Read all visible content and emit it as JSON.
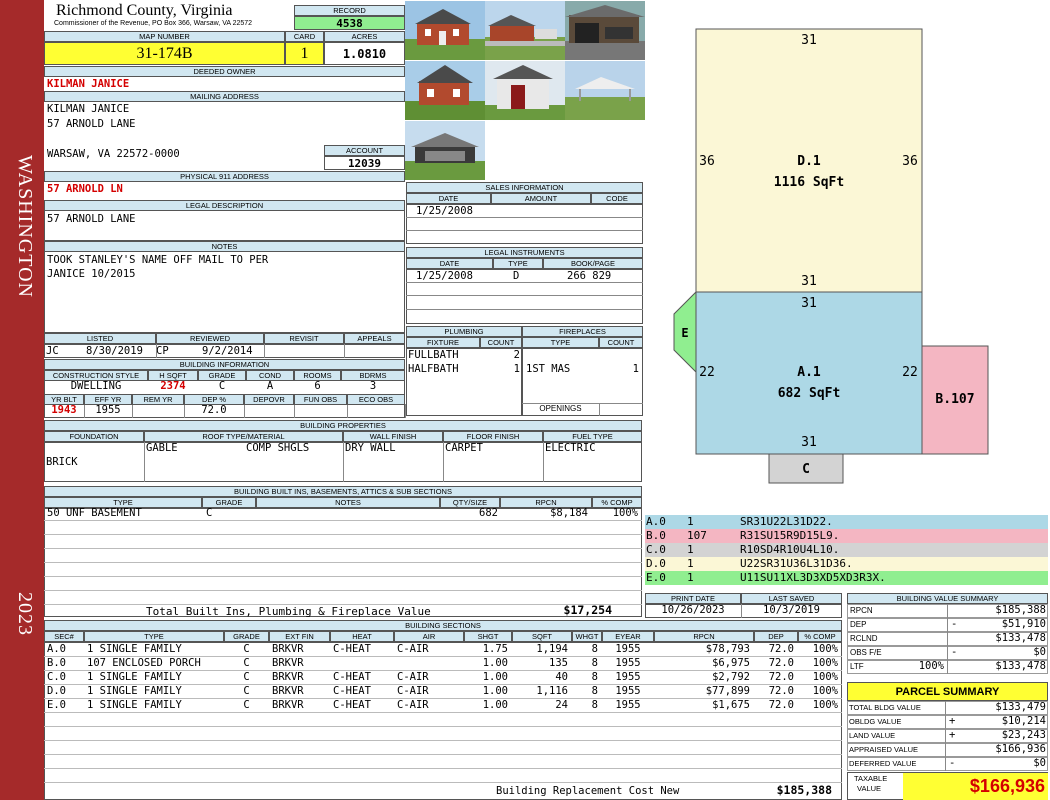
{
  "county": {
    "name": "Richmond County, Virginia",
    "office": "Commissioner of the Revenue, PO Box 366, Warsaw, VA 22572"
  },
  "side": {
    "district": "WASHINGTON",
    "year": "2023"
  },
  "record": {
    "label": "RECORD",
    "value": "4538"
  },
  "map": {
    "label": "MAP NUMBER",
    "value": "31-174B",
    "card_label": "CARD",
    "card": "1",
    "acres_label": "ACRES",
    "acres": "1.0810"
  },
  "deeded": {
    "label": "DEEDED OWNER",
    "value": "KILMAN JANICE"
  },
  "mailing": {
    "label": "MAILING ADDRESS",
    "line1": "KILMAN JANICE",
    "line2": "57 ARNOLD LANE",
    "line3": "WARSAW, VA 22572-0000",
    "account_label": "ACCOUNT",
    "account": "12039"
  },
  "physical": {
    "label": "PHYSICAL 911 ADDRESS",
    "value": "57 ARNOLD LN"
  },
  "legal": {
    "label": "LEGAL DESCRIPTION",
    "value": "57 ARNOLD LANE"
  },
  "notes": {
    "label": "NOTES",
    "line1": "TOOK STANLEY'S NAME OFF MAIL TO PER",
    "line2": "JANICE 10/2015"
  },
  "listed": {
    "listed_label": "LISTED",
    "reviewed_label": "REVIEWED",
    "revisit_label": "REVISIT",
    "appeals_label": "APPEALS",
    "listed_by": "JC",
    "listed_date": "8/30/2019",
    "reviewed_by": "CP",
    "reviewed_date": "9/2/2014"
  },
  "building_info": {
    "label": "BUILDING INFORMATION",
    "h1": [
      "CONSTRUCTION STYLE",
      "H SQFT",
      "GRADE",
      "COND",
      "ROOMS",
      "BDRMS"
    ],
    "v1": [
      "DWELLING",
      "2374",
      "C",
      "A",
      "6",
      "3"
    ],
    "h2": [
      "YR BLT",
      "EFF YR",
      "REM YR",
      "DEP %",
      "DEPOVR",
      "FUN OBS",
      "ECO OBS"
    ],
    "v2": [
      "1943",
      "1955",
      "",
      "72.0",
      "",
      "",
      ""
    ]
  },
  "sales": {
    "label": "SALES INFORMATION",
    "h": [
      "DATE",
      "AMOUNT",
      "CODE"
    ],
    "date": "1/25/2008"
  },
  "instruments": {
    "label": "LEGAL INSTRUMENTS",
    "h": [
      "DATE",
      "TYPE",
      "BOOK/PAGE"
    ],
    "date": "1/25/2008",
    "type": "D",
    "book": "266 829"
  },
  "plumbing": {
    "label": "PLUMBING",
    "h": [
      "FIXTURE",
      "COUNT"
    ],
    "rows": [
      [
        "FULLBATH",
        "2"
      ],
      [
        "HALFBATH",
        "1"
      ]
    ]
  },
  "fireplaces": {
    "label": "FIREPLACES",
    "h": [
      "TYPE",
      "COUNT"
    ],
    "type": "1ST MAS",
    "count": "1",
    "openings_label": "OPENINGS"
  },
  "properties": {
    "label": "BUILDING PROPERTIES",
    "h": [
      "FOUNDATION",
      "ROOF TYPE/MATERIAL",
      "WALL FINISH",
      "FLOOR FINISH",
      "FUEL TYPE"
    ],
    "foundation": "BRICK",
    "roof_type": "GABLE",
    "roof_mat": "COMP SHGLS",
    "wall": "DRY WALL",
    "floor": "CARPET",
    "fuel": "ELECTRIC"
  },
  "builtins": {
    "label": "BUILDING BUILT INS, BASEMENTS, ATTICS & SUB SECTIONS",
    "h": [
      "TYPE",
      "GRADE",
      "NOTES",
      "QTY/SIZE",
      "RPCN",
      "% COMP"
    ],
    "row": [
      "50 UNF BASEMENT",
      "C",
      "",
      "682",
      "$8,184",
      "100%"
    ],
    "total_label": "Total Built Ins, Plumbing & Fireplace Value",
    "total": "$17,254"
  },
  "sections": {
    "label": "BUILDING SECTIONS",
    "h": [
      "SEC#",
      "TYPE",
      "GRADE",
      "EXT FIN",
      "HEAT",
      "AIR",
      "SHGT",
      "SQFT",
      "WHGT",
      "EYEAR",
      "RPCN",
      "DEP",
      "% COMP"
    ],
    "rows": [
      [
        "A.0",
        "1 SINGLE FAMILY",
        "C",
        "BRKVR",
        "C-HEAT",
        "C-AIR",
        "1.75",
        "1,194",
        "8",
        "1955",
        "$78,793",
        "72.0",
        "100%"
      ],
      [
        "B.0",
        "107 ENCLOSED PORCH",
        "C",
        "BRKVR",
        "",
        "",
        "1.00",
        "135",
        "8",
        "1955",
        "$6,975",
        "72.0",
        "100%"
      ],
      [
        "C.0",
        "1 SINGLE FAMILY",
        "C",
        "BRKVR",
        "C-HEAT",
        "C-AIR",
        "1.00",
        "40",
        "8",
        "1955",
        "$2,792",
        "72.0",
        "100%"
      ],
      [
        "D.0",
        "1 SINGLE FAMILY",
        "C",
        "BRKVR",
        "C-HEAT",
        "C-AIR",
        "1.00",
        "1,116",
        "8",
        "1955",
        "$77,899",
        "72.0",
        "100%"
      ],
      [
        "E.0",
        "1 SINGLE FAMILY",
        "C",
        "BRKVR",
        "C-HEAT",
        "C-AIR",
        "1.00",
        "24",
        "8",
        "1955",
        "$1,675",
        "72.0",
        "100%"
      ]
    ],
    "total_label": "Building Replacement Cost New",
    "total": "$185,388"
  },
  "sketch": {
    "d_label": "D.1",
    "d_area": "1116 SqFt",
    "a_label": "A.1",
    "a_area": "682 SqFt",
    "b_label": "B.107",
    "c_label": "C",
    "e_label": "E",
    "dims": {
      "d_top": "31",
      "d_left": "36",
      "d_right": "36",
      "d_bottom": "31",
      "a_top": "31",
      "a_left": "22",
      "a_right": "22",
      "a_bottom": "31"
    },
    "colors": {
      "d": "#fbf7d6",
      "a": "#add8e6",
      "b": "#f4b6c2",
      "c": "#d3d3d3",
      "e": "#90ee90"
    }
  },
  "segments": [
    {
      "sec": "A.0",
      "code": "1",
      "vec": "SR31U22L31D22.",
      "color": "#add8e6"
    },
    {
      "sec": "B.0",
      "code": "107",
      "vec": "R31SU15R9D15L9.",
      "color": "#f4b6c2"
    },
    {
      "sec": "C.0",
      "code": "1",
      "vec": "R10SD4R10U4L10.",
      "color": "#d3d3d3"
    },
    {
      "sec": "D.0",
      "code": "1",
      "vec": "U22SR31U36L31D36.",
      "color": "#fbf7d6"
    },
    {
      "sec": "E.0",
      "code": "1",
      "vec": "U11SU11XL3D3XD5XD3R3X.",
      "color": "#90ee90"
    }
  ],
  "print": {
    "print_label": "PRINT DATE",
    "print_date": "10/26/2023",
    "saved_label": "LAST SAVED",
    "saved_date": "10/3/2019"
  },
  "bvs": {
    "label": "BUILDING VALUE SUMMARY",
    "rows": [
      [
        "RPCN",
        "",
        "$185,388"
      ],
      [
        "DEP",
        "-",
        "$51,910"
      ],
      [
        "RCLND",
        "",
        "$133,478"
      ],
      [
        "OBS F/E",
        "-",
        "$0"
      ],
      [
        "LTF",
        "100%",
        "$133,478"
      ]
    ]
  },
  "parcel": {
    "label": "PARCEL SUMMARY",
    "rows": [
      [
        "TOTAL BLDG VALUE",
        "",
        "$133,479"
      ],
      [
        "OBLDG VALUE",
        "+",
        "$10,214"
      ],
      [
        "LAND VALUE",
        "+",
        "$23,243"
      ],
      [
        "APPRAISED VALUE",
        "",
        "$166,936"
      ],
      [
        "DEFERRED VALUE",
        "-",
        "$0"
      ]
    ],
    "taxable_label1": "TAXABLE",
    "taxable_label2": "VALUE",
    "taxable": "$166,936"
  }
}
